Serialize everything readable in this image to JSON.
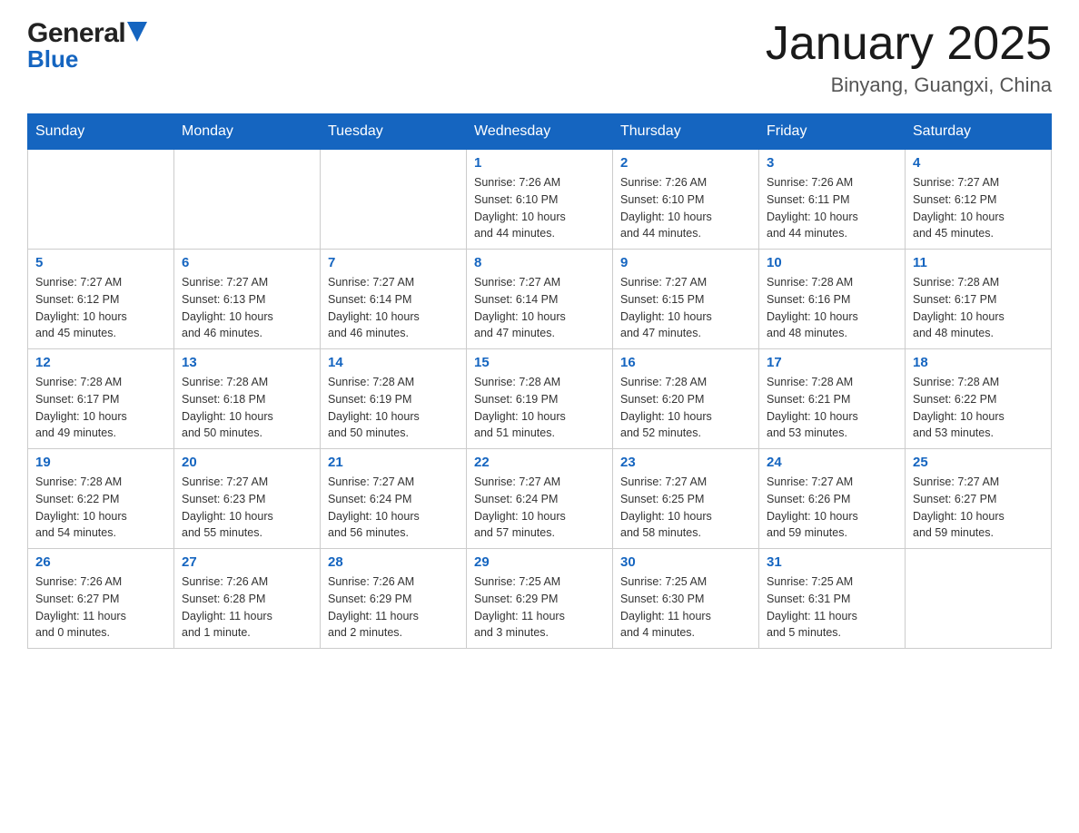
{
  "header": {
    "logo_general": "General",
    "logo_blue": "Blue",
    "title": "January 2025",
    "subtitle": "Binyang, Guangxi, China"
  },
  "days_of_week": [
    "Sunday",
    "Monday",
    "Tuesday",
    "Wednesday",
    "Thursday",
    "Friday",
    "Saturday"
  ],
  "weeks": [
    {
      "days": [
        {
          "number": "",
          "info": ""
        },
        {
          "number": "",
          "info": ""
        },
        {
          "number": "",
          "info": ""
        },
        {
          "number": "1",
          "info": "Sunrise: 7:26 AM\nSunset: 6:10 PM\nDaylight: 10 hours\nand 44 minutes."
        },
        {
          "number": "2",
          "info": "Sunrise: 7:26 AM\nSunset: 6:10 PM\nDaylight: 10 hours\nand 44 minutes."
        },
        {
          "number": "3",
          "info": "Sunrise: 7:26 AM\nSunset: 6:11 PM\nDaylight: 10 hours\nand 44 minutes."
        },
        {
          "number": "4",
          "info": "Sunrise: 7:27 AM\nSunset: 6:12 PM\nDaylight: 10 hours\nand 45 minutes."
        }
      ]
    },
    {
      "days": [
        {
          "number": "5",
          "info": "Sunrise: 7:27 AM\nSunset: 6:12 PM\nDaylight: 10 hours\nand 45 minutes."
        },
        {
          "number": "6",
          "info": "Sunrise: 7:27 AM\nSunset: 6:13 PM\nDaylight: 10 hours\nand 46 minutes."
        },
        {
          "number": "7",
          "info": "Sunrise: 7:27 AM\nSunset: 6:14 PM\nDaylight: 10 hours\nand 46 minutes."
        },
        {
          "number": "8",
          "info": "Sunrise: 7:27 AM\nSunset: 6:14 PM\nDaylight: 10 hours\nand 47 minutes."
        },
        {
          "number": "9",
          "info": "Sunrise: 7:27 AM\nSunset: 6:15 PM\nDaylight: 10 hours\nand 47 minutes."
        },
        {
          "number": "10",
          "info": "Sunrise: 7:28 AM\nSunset: 6:16 PM\nDaylight: 10 hours\nand 48 minutes."
        },
        {
          "number": "11",
          "info": "Sunrise: 7:28 AM\nSunset: 6:17 PM\nDaylight: 10 hours\nand 48 minutes."
        }
      ]
    },
    {
      "days": [
        {
          "number": "12",
          "info": "Sunrise: 7:28 AM\nSunset: 6:17 PM\nDaylight: 10 hours\nand 49 minutes."
        },
        {
          "number": "13",
          "info": "Sunrise: 7:28 AM\nSunset: 6:18 PM\nDaylight: 10 hours\nand 50 minutes."
        },
        {
          "number": "14",
          "info": "Sunrise: 7:28 AM\nSunset: 6:19 PM\nDaylight: 10 hours\nand 50 minutes."
        },
        {
          "number": "15",
          "info": "Sunrise: 7:28 AM\nSunset: 6:19 PM\nDaylight: 10 hours\nand 51 minutes."
        },
        {
          "number": "16",
          "info": "Sunrise: 7:28 AM\nSunset: 6:20 PM\nDaylight: 10 hours\nand 52 minutes."
        },
        {
          "number": "17",
          "info": "Sunrise: 7:28 AM\nSunset: 6:21 PM\nDaylight: 10 hours\nand 53 minutes."
        },
        {
          "number": "18",
          "info": "Sunrise: 7:28 AM\nSunset: 6:22 PM\nDaylight: 10 hours\nand 53 minutes."
        }
      ]
    },
    {
      "days": [
        {
          "number": "19",
          "info": "Sunrise: 7:28 AM\nSunset: 6:22 PM\nDaylight: 10 hours\nand 54 minutes."
        },
        {
          "number": "20",
          "info": "Sunrise: 7:27 AM\nSunset: 6:23 PM\nDaylight: 10 hours\nand 55 minutes."
        },
        {
          "number": "21",
          "info": "Sunrise: 7:27 AM\nSunset: 6:24 PM\nDaylight: 10 hours\nand 56 minutes."
        },
        {
          "number": "22",
          "info": "Sunrise: 7:27 AM\nSunset: 6:24 PM\nDaylight: 10 hours\nand 57 minutes."
        },
        {
          "number": "23",
          "info": "Sunrise: 7:27 AM\nSunset: 6:25 PM\nDaylight: 10 hours\nand 58 minutes."
        },
        {
          "number": "24",
          "info": "Sunrise: 7:27 AM\nSunset: 6:26 PM\nDaylight: 10 hours\nand 59 minutes."
        },
        {
          "number": "25",
          "info": "Sunrise: 7:27 AM\nSunset: 6:27 PM\nDaylight: 10 hours\nand 59 minutes."
        }
      ]
    },
    {
      "days": [
        {
          "number": "26",
          "info": "Sunrise: 7:26 AM\nSunset: 6:27 PM\nDaylight: 11 hours\nand 0 minutes."
        },
        {
          "number": "27",
          "info": "Sunrise: 7:26 AM\nSunset: 6:28 PM\nDaylight: 11 hours\nand 1 minute."
        },
        {
          "number": "28",
          "info": "Sunrise: 7:26 AM\nSunset: 6:29 PM\nDaylight: 11 hours\nand 2 minutes."
        },
        {
          "number": "29",
          "info": "Sunrise: 7:25 AM\nSunset: 6:29 PM\nDaylight: 11 hours\nand 3 minutes."
        },
        {
          "number": "30",
          "info": "Sunrise: 7:25 AM\nSunset: 6:30 PM\nDaylight: 11 hours\nand 4 minutes."
        },
        {
          "number": "31",
          "info": "Sunrise: 7:25 AM\nSunset: 6:31 PM\nDaylight: 11 hours\nand 5 minutes."
        },
        {
          "number": "",
          "info": ""
        }
      ]
    }
  ]
}
